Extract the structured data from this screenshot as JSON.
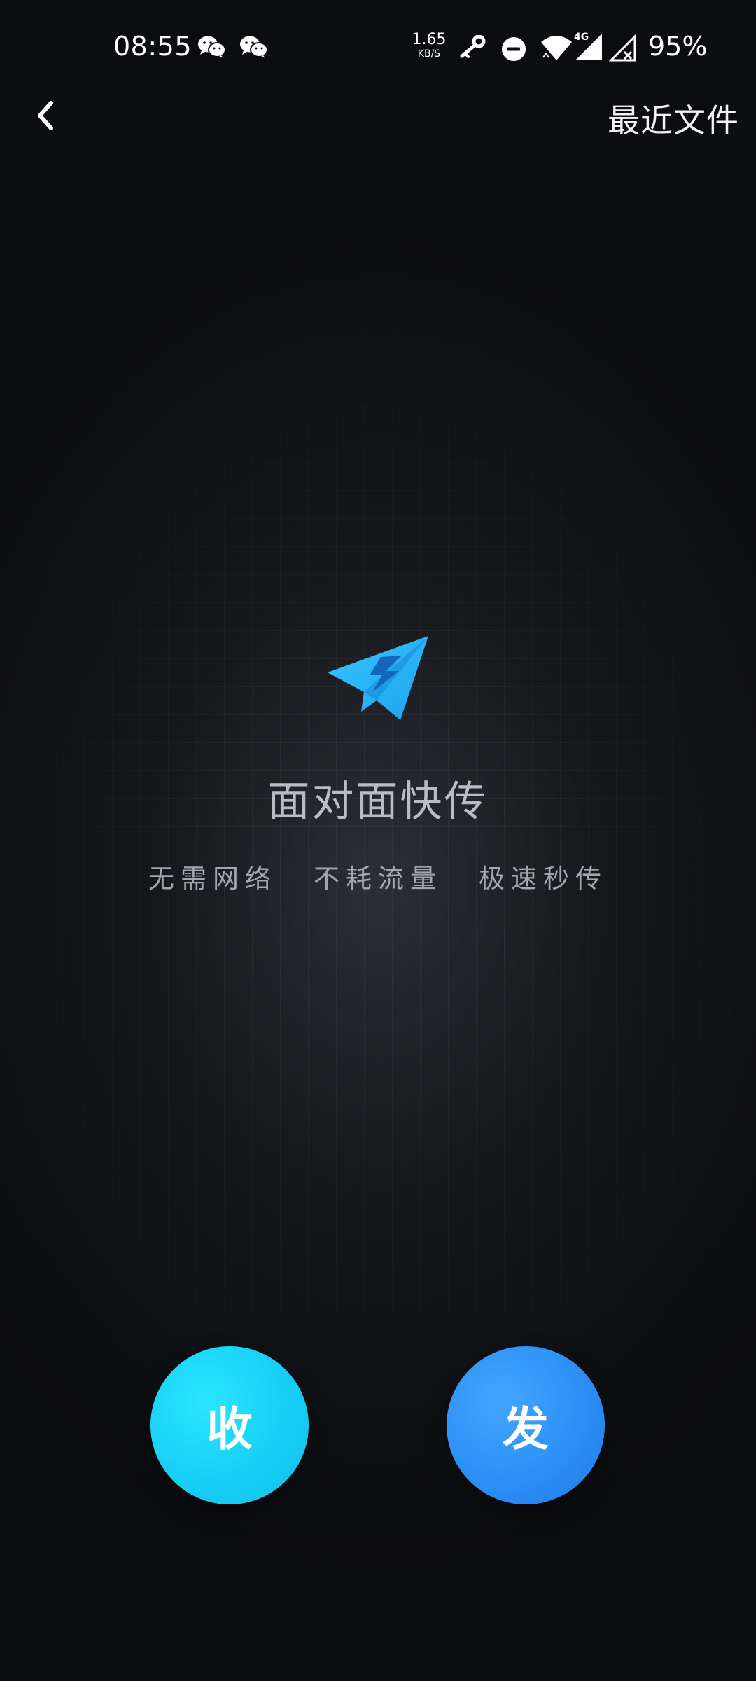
{
  "status_bar": {
    "time": "08:55",
    "net_speed_value": "1.65",
    "net_speed_unit": "KB/S",
    "network_type": "4G",
    "battery_percent": "95%",
    "icons": [
      "wechat-icon",
      "wechat-icon",
      "key-icon",
      "do-not-disturb-icon",
      "wifi-icon",
      "signal-4g-icon",
      "signal-no-sim-icon"
    ]
  },
  "nav": {
    "back_icon": "chevron-left-icon",
    "recent_files_label": "最近文件"
  },
  "main": {
    "logo_icon": "paper-plane-lightning-icon",
    "title": "面对面快传",
    "slogans": [
      "无需网络",
      "不耗流量",
      "极速秒传"
    ]
  },
  "actions": {
    "receive_label": "收",
    "send_label": "发"
  },
  "colors": {
    "receive_button": "#17cff5",
    "send_button": "#2c8ff6",
    "logo_primary": "#27b8f6",
    "background": "#0b0c0f"
  }
}
